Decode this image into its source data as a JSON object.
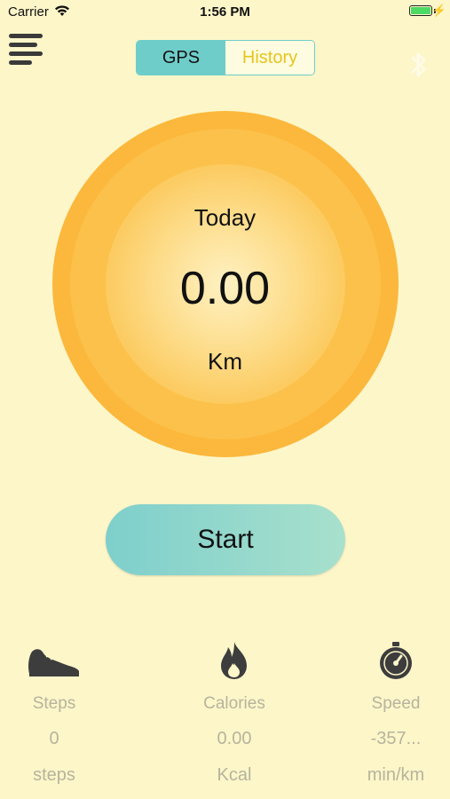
{
  "status_bar": {
    "carrier": "Carrier",
    "time": "1:56 PM"
  },
  "header": {
    "tabs": [
      {
        "label": "GPS",
        "active": true
      },
      {
        "label": "History",
        "active": false
      }
    ],
    "menu_icon": "hamburger-menu-icon",
    "bluetooth_icon": "bluetooth-icon"
  },
  "summary": {
    "period": "Today",
    "distance": "0.00",
    "unit": "Km"
  },
  "start_button": {
    "label": "Start"
  },
  "stats": [
    {
      "icon": "shoe-icon",
      "label": "Steps",
      "value": "0",
      "unit": "steps"
    },
    {
      "icon": "flame-icon",
      "label": "Calories",
      "value": "0.00",
      "unit": "Kcal"
    },
    {
      "icon": "speedometer-icon",
      "label": "Speed",
      "value": "-357...",
      "unit": "min/km"
    }
  ],
  "colors": {
    "background": "#fdf6c9",
    "accent_teal": "#6fcdc9",
    "orange": "#fbb83c",
    "history_yellow": "#e6c51e",
    "stat_gray": "#b7b49d"
  }
}
